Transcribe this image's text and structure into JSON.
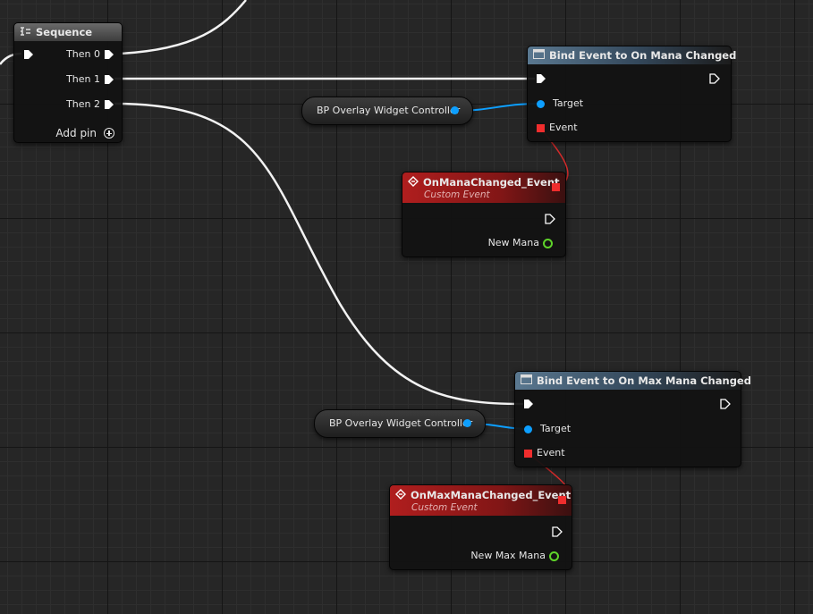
{
  "sequence": {
    "title": "Sequence",
    "outputs": [
      "Then 0",
      "Then 1",
      "Then 2"
    ],
    "add_pin": "Add pin"
  },
  "bind_mana": {
    "title": "Bind Event to On Mana Changed",
    "target_label": "Target",
    "event_label": "Event"
  },
  "getter_1": {
    "label": "BP Overlay Widget Controller"
  },
  "event_mana": {
    "title": "OnManaChanged_Event",
    "subtitle": "Custom Event",
    "param": "New Mana"
  },
  "bind_max_mana": {
    "title": "Bind Event to On Max Mana Changed",
    "target_label": "Target",
    "event_label": "Event"
  },
  "getter_2": {
    "label": "BP Overlay Widget Controller"
  },
  "event_max_mana": {
    "title": "OnMaxManaChanged_Event",
    "subtitle": "Custom Event",
    "param": "New Max Mana"
  },
  "colors": {
    "exec_wire": "#ffffff",
    "object_pin": "#0d9fff",
    "delegate_pin": "#f02d2d",
    "float_pin": "#5fd42a",
    "event_header": "#b01e1e",
    "function_header": "#5a7890"
  }
}
